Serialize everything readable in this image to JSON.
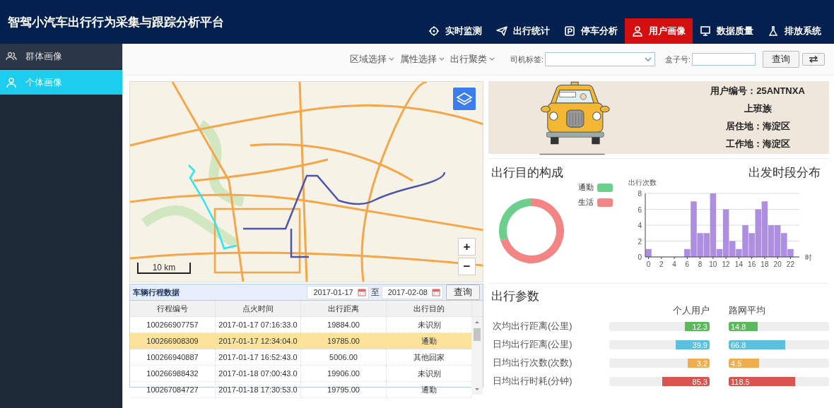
{
  "header": {
    "title": "智驾小汽车出行行为采集与跟踪分析平台",
    "nav": [
      {
        "label": "实时监测",
        "selected": false
      },
      {
        "label": "出行统计",
        "selected": false
      },
      {
        "label": "停车分析",
        "selected": false
      },
      {
        "label": "用户画像",
        "selected": true
      },
      {
        "label": "数据质量",
        "selected": false
      },
      {
        "label": "排放系统",
        "selected": false
      }
    ]
  },
  "sidebar": {
    "items": [
      {
        "label": "群体画像",
        "selected": false
      },
      {
        "label": "个体画像",
        "selected": true
      }
    ]
  },
  "toolbar": {
    "filters": [
      "区域选择",
      "属性选择",
      "出行聚类"
    ],
    "driver_tag_label": "司机标签:",
    "box_label": "盒子号:",
    "query": "查询"
  },
  "map": {
    "scale": "10 km",
    "zoom_in": "+",
    "zoom_out": "−"
  },
  "trips": {
    "title": "车辆行程数据",
    "date_from": "2017-01-17",
    "to": "至",
    "date_to": "2017-02-08",
    "query": "查询",
    "columns": [
      "行程编号",
      "点火时间",
      "出行距离",
      "出行目的"
    ],
    "rows": [
      {
        "cells": [
          "100266907757",
          "2017-01-17 07:16:33.0",
          "19884.00",
          "未识别"
        ],
        "selected": false
      },
      {
        "cells": [
          "100266908309",
          "2017-01-17 12:34:04.0",
          "19785.00",
          "通勤"
        ],
        "selected": true
      },
      {
        "cells": [
          "100266940887",
          "2017-01-17 16:52:43.0",
          "5006.00",
          "其他回家"
        ],
        "selected": false
      },
      {
        "cells": [
          "100266988432",
          "2017-01-18 07:00:43.0",
          "19906.00",
          "未识别"
        ],
        "selected": false
      },
      {
        "cells": [
          "100267084727",
          "2017-01-18 17:30:53.0",
          "19795.00",
          "通勤"
        ],
        "selected": false
      }
    ]
  },
  "profile": {
    "lines": [
      "用户编号：25ANTNXA",
      "上班族",
      "居住地：海淀区",
      "工作地：海淀区"
    ]
  },
  "purpose": {
    "title": "出行目的构成",
    "legend": [
      {
        "color": "#6dcf8e"
      },
      {
        "color": "#f38585"
      }
    ],
    "chart_data": {
      "type": "donut",
      "categories": [
        "通勤",
        "生活"
      ],
      "series": [
        {
          "values": [
            30,
            70
          ]
        }
      ]
    }
  },
  "departure": {
    "title": "出发时段分布",
    "chart_data": {
      "type": "bar",
      "ylabel": "出行次数",
      "xlabel": "时",
      "x": [
        0,
        1,
        2,
        3,
        4,
        5,
        6,
        7,
        8,
        9,
        10,
        11,
        12,
        13,
        14,
        15,
        16,
        17,
        18,
        19,
        20,
        21,
        22
      ],
      "grid": true,
      "series": [
        {
          "color": "#ae8ee0",
          "values": [
            1,
            0,
            0,
            0,
            0,
            0,
            1,
            7,
            3,
            3,
            8,
            1,
            6,
            2,
            1,
            4,
            3,
            6,
            7,
            4,
            4,
            3,
            1
          ]
        }
      ],
      "xlim": [
        -0.5,
        22.5
      ],
      "ylim": [
        0,
        8
      ],
      "yticks": [
        0,
        2,
        4,
        6,
        8
      ],
      "xticks": [
        0,
        2,
        4,
        6,
        8,
        10,
        12,
        14,
        16,
        18,
        20,
        22
      ]
    }
  },
  "params": {
    "title": "出行参数",
    "columns": [
      "个人用户",
      "路网平均"
    ],
    "rows": [
      {
        "label": "次均出行距离(公里)",
        "color": "#5cb85c",
        "user": {
          "value": "12.3",
          "level": 0.25
        },
        "network": {
          "value": "14.8",
          "level": 0.29
        }
      },
      {
        "label": "日均出行距离(公里)",
        "color": "#5bc0de",
        "user": {
          "value": "39.9",
          "level": 0.34
        },
        "network": {
          "value": "66.8",
          "level": 0.56
        }
      },
      {
        "label": "日均出行次数(次数)",
        "color": "#f0ad4e",
        "user": {
          "value": "3.2",
          "level": 0.22
        },
        "network": {
          "value": "4.5",
          "level": 0.3
        }
      },
      {
        "label": "日均出行时耗(分钟)",
        "color": "#d9534f",
        "user": {
          "value": "85.3",
          "level": 0.47
        },
        "network": {
          "value": "118.5",
          "level": 0.66
        }
      }
    ]
  }
}
